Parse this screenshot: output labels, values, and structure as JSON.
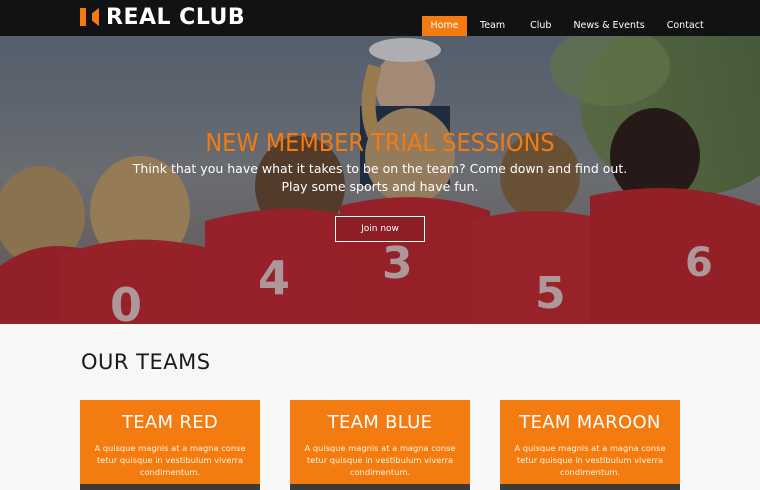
{
  "header": {
    "brand": "REAL CLUB",
    "nav": [
      {
        "label": "Home",
        "active": true
      },
      {
        "label": "Team",
        "active": false
      },
      {
        "label": "Club",
        "active": false
      },
      {
        "label": "News & Events",
        "active": false
      },
      {
        "label": "Contact",
        "active": false
      }
    ]
  },
  "hero": {
    "title": "NEW MEMBER TRIAL SESSIONS",
    "subtitle_line1": "Think that you have what it takes to be on the team? Come down and find out.",
    "subtitle_line2": "Play some sports and have fun.",
    "button_label": "Join now"
  },
  "teams": {
    "heading": "OUR TEAMS",
    "cards": [
      {
        "title": "TEAM RED",
        "text": "A quisque magnis at a magna conse tetur quisque in vestibulum viverra condimentum."
      },
      {
        "title": "TEAM BLUE",
        "text": "A quisque magnis at a magna conse tetur quisque in vestibulum viverra condimentum."
      },
      {
        "title": "TEAM MAROON",
        "text": "A quisque magnis at a magna conse tetur quisque in vestibulum viverra condimentum."
      }
    ]
  },
  "colors": {
    "accent": "#f47b10",
    "header_bg": "#111214",
    "page_bg": "#f7f7f7"
  }
}
